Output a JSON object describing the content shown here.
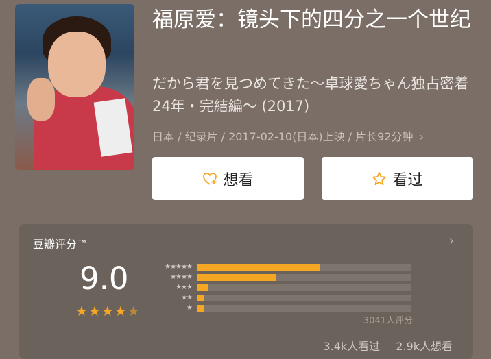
{
  "movie": {
    "title": "福原爱：镜头下的四分之一个世纪",
    "original_title": "だから君を見つめてきた～卓球愛ちゃん独占密着24年・完結編～ (2017)",
    "meta": "日本 / 纪录片 / 2017-02-10(日本)上映 / 片长92分钟",
    "meta_chevron": "›"
  },
  "actions": {
    "want_label": "想看",
    "seen_label": "看过"
  },
  "rating": {
    "title": "豆瓣评分™",
    "score": "9.0",
    "stars": 4.5,
    "distribution": [
      {
        "stars": "★★★★★",
        "fraction": 0.57
      },
      {
        "stars": "★★★★",
        "fraction": 0.37
      },
      {
        "stars": "★★★",
        "fraction": 0.05
      },
      {
        "stars": "★★",
        "fraction": 0.03
      },
      {
        "stars": "★",
        "fraction": 0.03
      }
    ],
    "votes": "3041人评分",
    "watched": "3.4k人看过",
    "wish": "2.9k人想看",
    "chevron": "›"
  },
  "colors": {
    "background": "#7a6e66",
    "accent": "#f5a623",
    "card": "#6b625b"
  }
}
